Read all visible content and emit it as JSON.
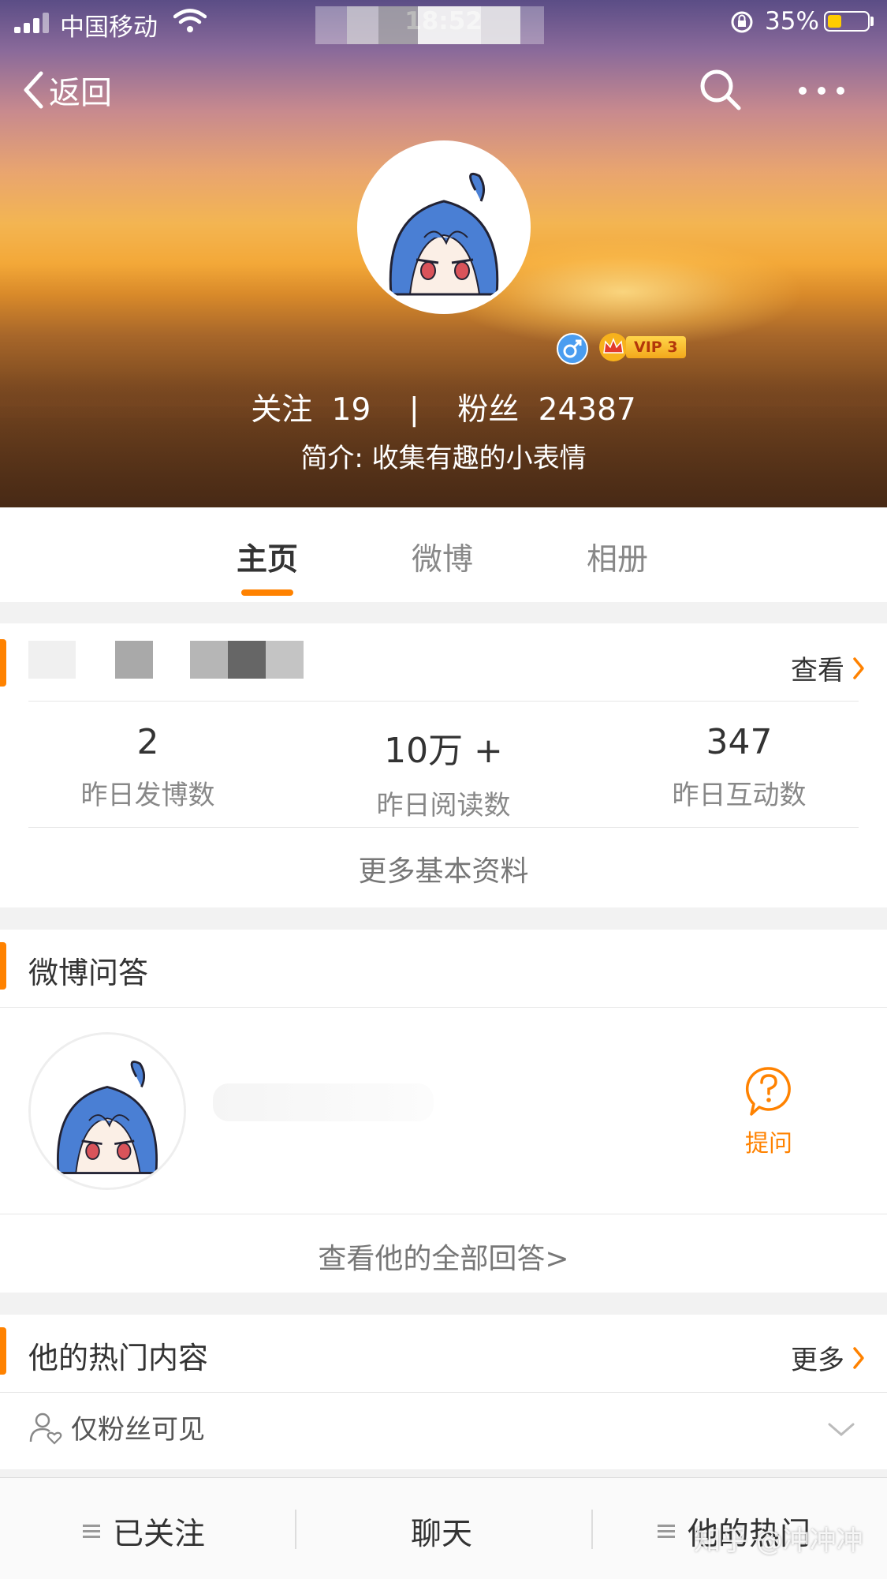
{
  "status_bar": {
    "carrier": "中国移动",
    "time": "18:52",
    "battery": "35%",
    "battery_level": 0.35
  },
  "nav": {
    "back_label": "返回"
  },
  "profile": {
    "vip_label": "VIP 3",
    "following_label": "关注",
    "following_count": "19",
    "separator": "|",
    "followers_label": "粉丝",
    "followers_count": "24387",
    "bio": "简介: 收集有趣的小表情"
  },
  "tabs": [
    "主页",
    "微博",
    "相册"
  ],
  "stats_card": {
    "view_label": "查看",
    "metrics": [
      {
        "value": "2",
        "label": "昨日发博数"
      },
      {
        "value": "10万 +",
        "label": "昨日阅读数"
      },
      {
        "value": "347",
        "label": "昨日互动数"
      }
    ],
    "more_info": "更多基本资料"
  },
  "qa_card": {
    "title": "微博问答",
    "ask_label": "提问",
    "view_all": "查看他的全部回答>"
  },
  "hot_card": {
    "title": "他的热门内容",
    "more_label": "更多",
    "fans_only": "仅粉丝可见"
  },
  "bottom_bar": {
    "follow": "已关注",
    "chat": "聊天",
    "hot": "他的热门"
  },
  "watermark": "知乎 @冲冲冲",
  "colors": {
    "accent": "#ff8200",
    "gender_badge": "#4a9df0"
  }
}
